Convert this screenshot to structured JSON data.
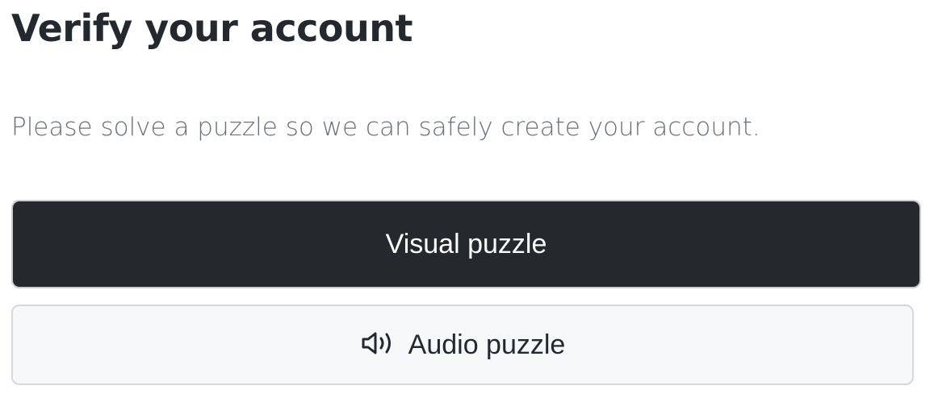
{
  "header": {
    "title": "Verify your account",
    "subtitle": "Please solve a puzzle so we can safely create your account."
  },
  "options": {
    "visual_label": "Visual puzzle",
    "audio_label": "Audio puzzle",
    "audio_icon": "speaker-icon"
  },
  "colors": {
    "primary_button_bg": "#25282d",
    "secondary_button_bg": "#f6f8fa",
    "text": "#24292f",
    "muted_text": "#6a7079"
  }
}
